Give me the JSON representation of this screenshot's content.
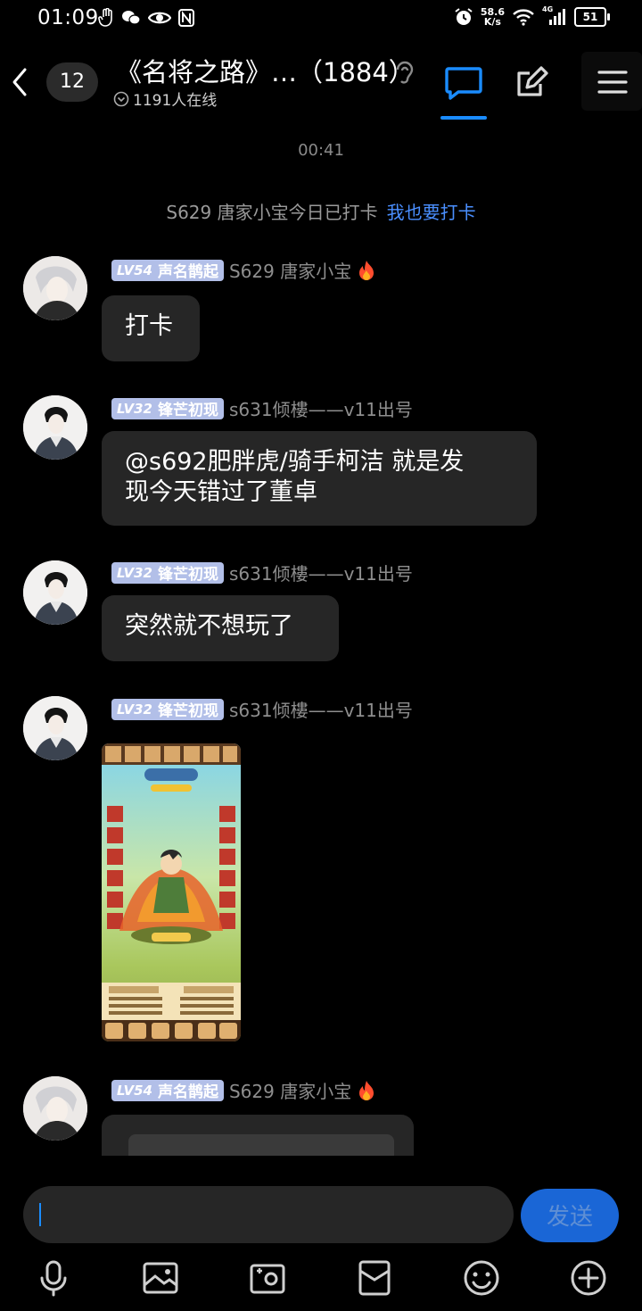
{
  "status_bar": {
    "time": "01:09",
    "net_speed_value": "58.6",
    "net_speed_unit": "K/s",
    "network_type": "4G",
    "battery": "51"
  },
  "header": {
    "back_label": "",
    "unread_count": "12",
    "title": "《名将之路》…（1884）",
    "online_text": "1191人在线"
  },
  "timestamp": "00:41",
  "notice": {
    "text": "S629 唐家小宝今日已打卡",
    "link": "我也要打卡"
  },
  "messages": [
    {
      "level": "LV54",
      "title_badge": "声名鹊起",
      "sender": "S629 唐家小宝",
      "text": "打卡"
    },
    {
      "level": "LV32",
      "title_badge": "锋芒初现",
      "sender": "s631倾樓——v11出号",
      "text_line1": "@s692肥胖虎/骑手柯洁 就是发",
      "text_line2": "现今天错过了董卓"
    },
    {
      "level": "LV32",
      "title_badge": "锋芒初现",
      "sender": "s631倾樓——v11出号",
      "text": "突然就不想玩了"
    },
    {
      "level": "LV32",
      "title_badge": "锋芒初现",
      "sender": "s631倾樓——v11出号",
      "image": "game-screenshot"
    },
    {
      "level": "LV54",
      "title_badge": "声名鹊起",
      "sender": "S629 唐家小宝"
    }
  ],
  "input": {
    "placeholder": "",
    "value": ""
  },
  "send_button": "发送",
  "toolbar_icons": [
    "microphone-icon",
    "image-icon",
    "camera-icon",
    "red-packet-icon",
    "emoji-icon",
    "plus-icon"
  ],
  "colors": {
    "accent": "#1a8cff",
    "bubble": "#262626",
    "level_badge": "#b2bfe8",
    "link": "#4a8fff"
  }
}
